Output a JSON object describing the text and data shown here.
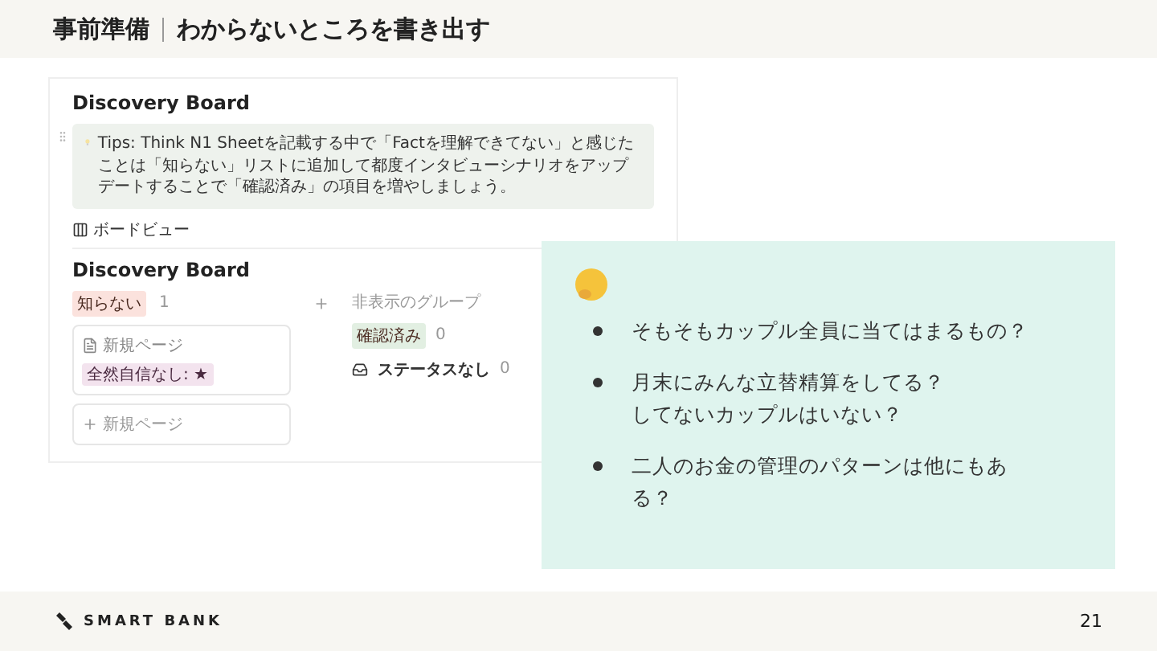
{
  "header": {
    "title": "事前準備",
    "subtitle": "わからないところを書き出す"
  },
  "notion": {
    "title": "Discovery Board",
    "callout": "Tips: Think N1 Sheetを記載する中で「Factを理解できてない」と感じたことは「知らない」リストに追加して都度インタビューシナリオをアップデートすることで「確認済み」の項目を増やしましょう。",
    "view_tab": "ボードビュー",
    "board_title": "Discovery Board",
    "columns": [
      {
        "label": "知らない",
        "count": "1",
        "color": "#fbe2dd",
        "cards": [
          {
            "title": "新規ページ",
            "tag": "全然自信なし: ★"
          }
        ],
        "new_label": "新規ページ"
      }
    ],
    "hidden": {
      "label": "非表示のグループ",
      "groups": [
        {
          "kind": "tag",
          "label": "確認済み",
          "count": "0",
          "color": "#e2efe2"
        },
        {
          "kind": "inbox",
          "label": "ステータスなし",
          "count": "0"
        }
      ]
    }
  },
  "note": {
    "bullets": [
      {
        "lines": [
          "そもそもカップル全員に当てはまるもの？"
        ]
      },
      {
        "lines": [
          "月末にみんな立替精算をしてる？",
          "してないカップルはいない？"
        ]
      },
      {
        "lines": [
          "二人のお金の管理のパターンは他にもある？"
        ]
      }
    ]
  },
  "footer": {
    "brand": "SMART BANK",
    "page": "21"
  }
}
